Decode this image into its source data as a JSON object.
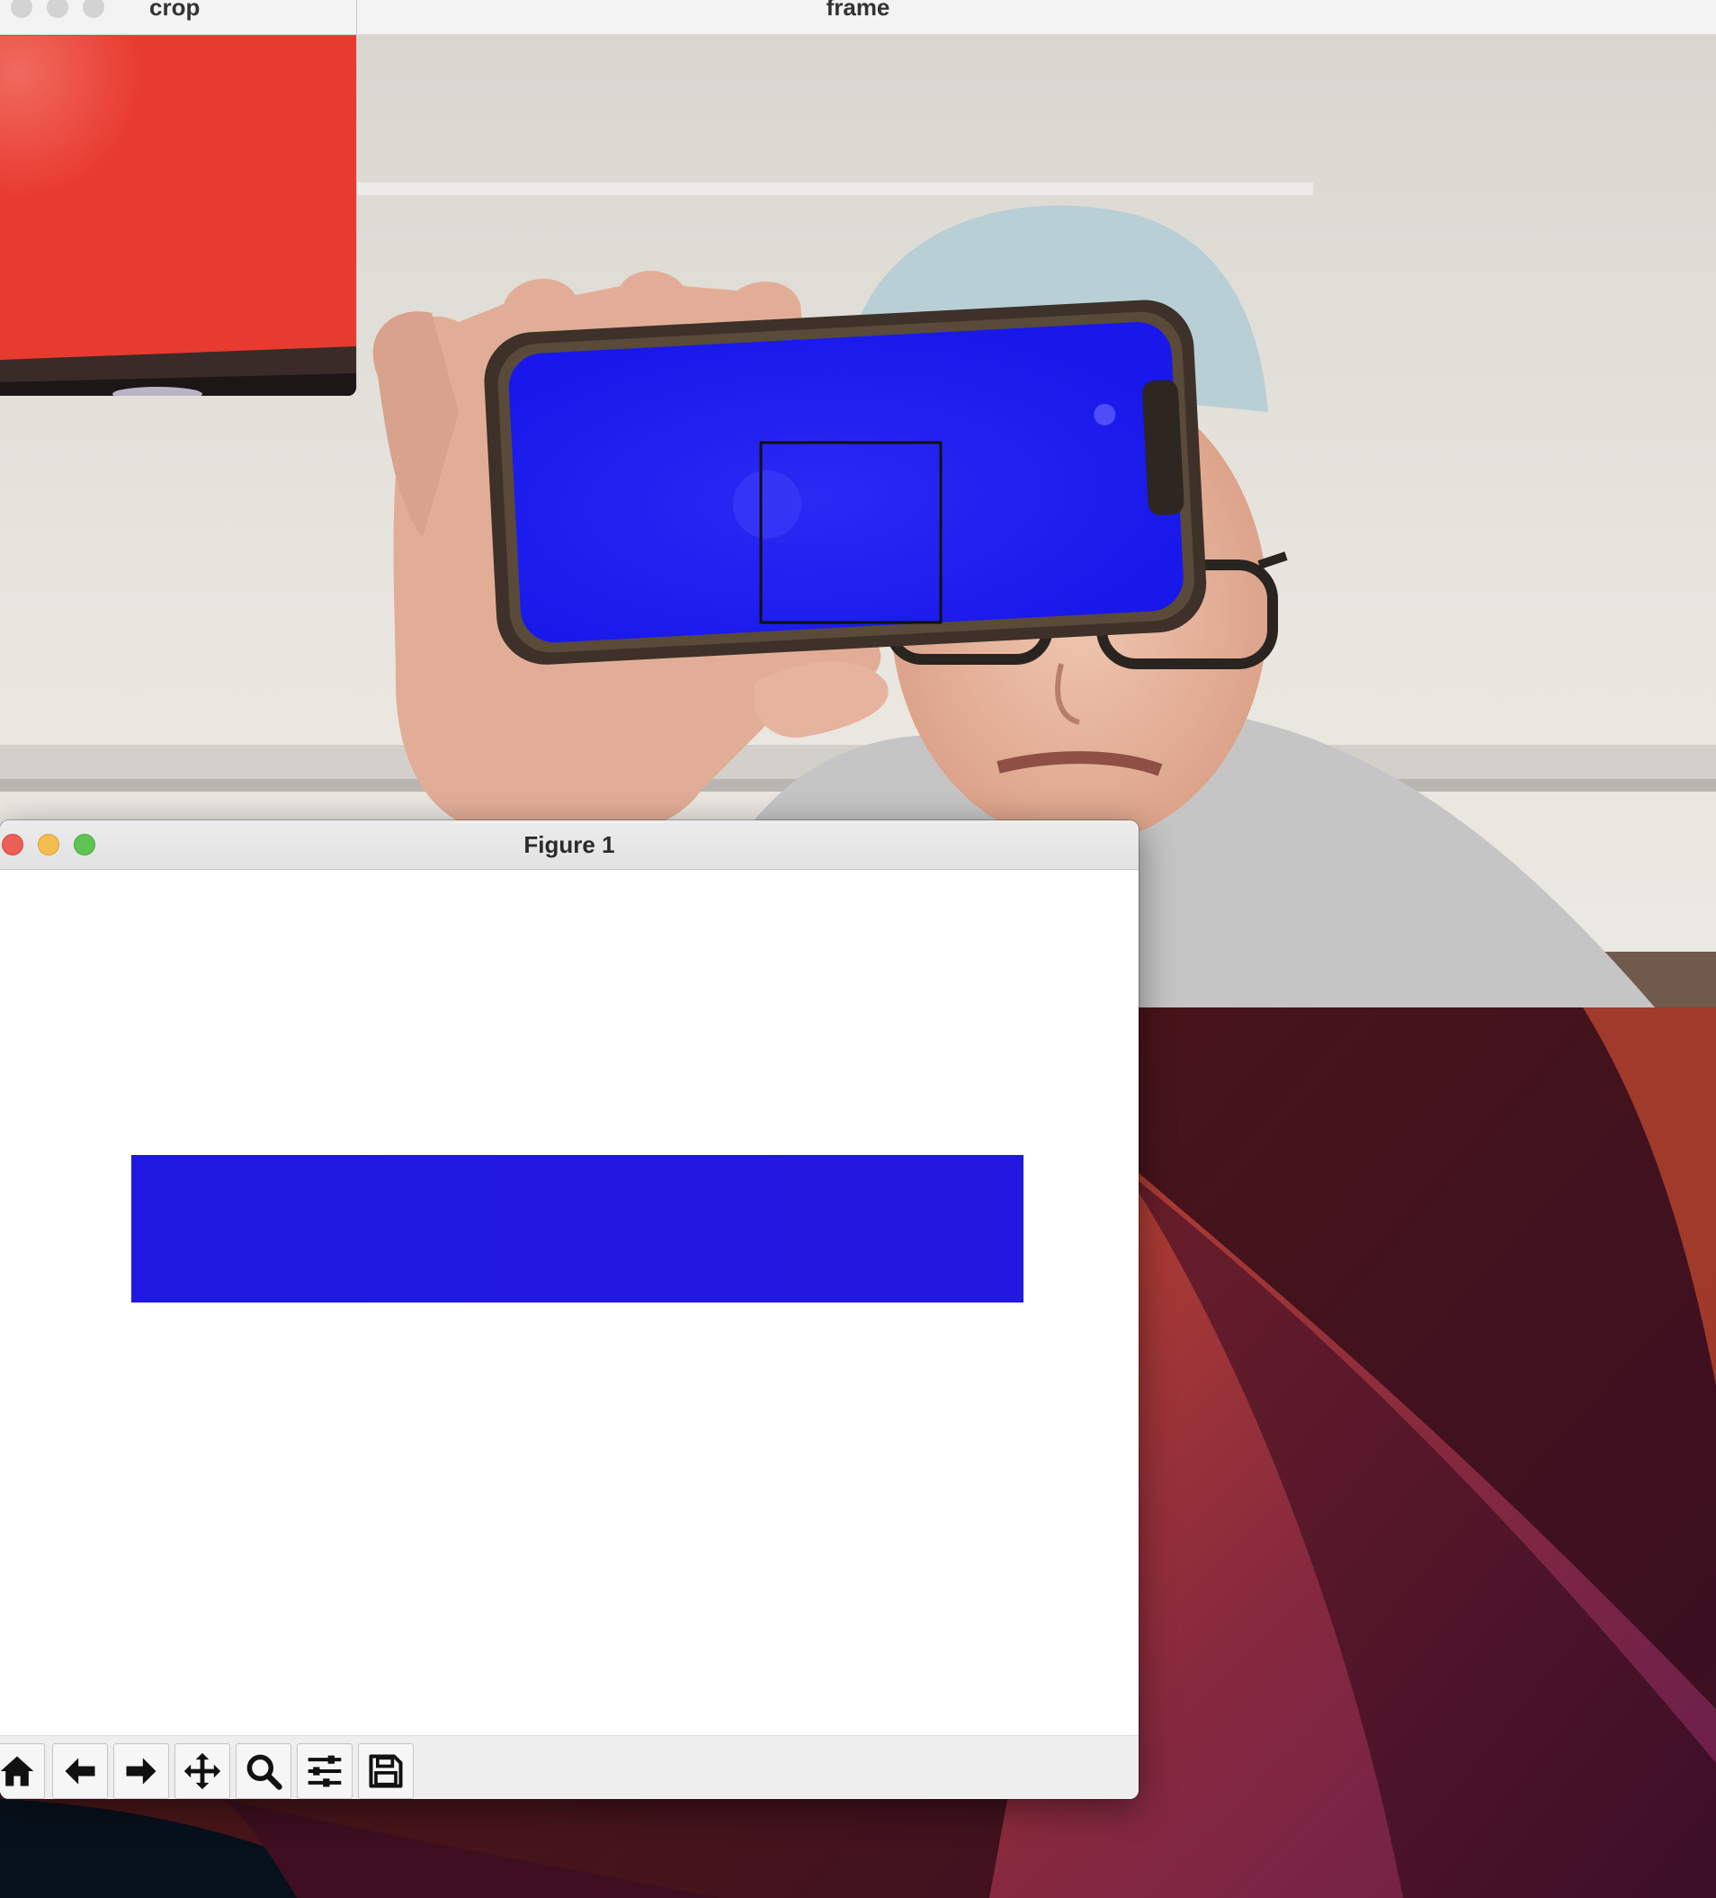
{
  "windows": {
    "frame": {
      "title": "frame"
    },
    "crop": {
      "title": "crop"
    },
    "figure": {
      "title": "Figure 1",
      "toolbar": [
        {
          "name": "home-icon"
        },
        {
          "name": "back-arrow-icon"
        },
        {
          "name": "forward-arrow-icon"
        },
        {
          "name": "pan-icon"
        },
        {
          "name": "zoom-icon"
        },
        {
          "name": "subplots-icon"
        },
        {
          "name": "save-icon"
        }
      ]
    }
  },
  "colors": {
    "phone_screen_blue": "#1e1ef0",
    "figure_swatch_blue": "#2018e0",
    "crop_red": "#e83b30",
    "close_red": "#ec5f57",
    "minimize_yellow": "#f5bd4f",
    "maximize_green": "#5fc453",
    "inactive_grey": "#d3d3d3"
  }
}
